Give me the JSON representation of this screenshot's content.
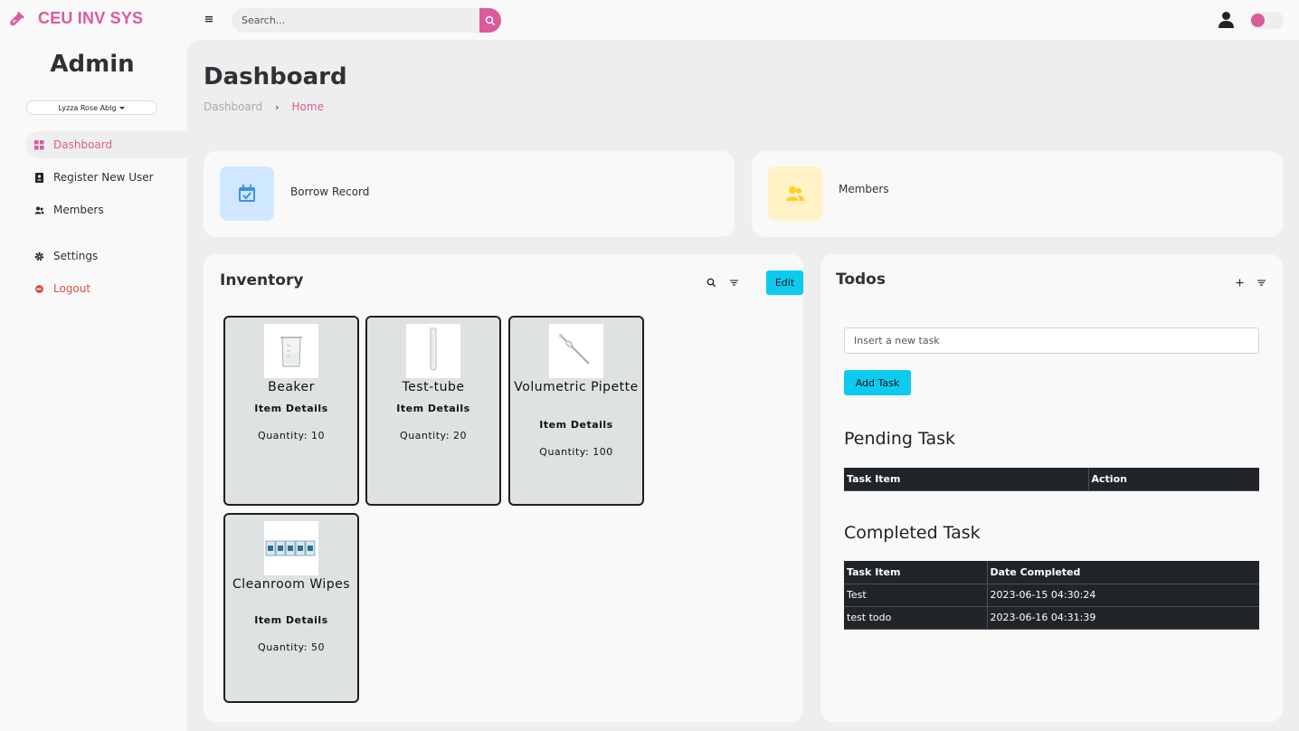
{
  "app": {
    "brand": "CEU INV SYS",
    "brand_color": "#db5a9a",
    "search_placeholder": "Search..."
  },
  "sidebar": {
    "title": "Admin",
    "user_name": "Lyzza Rose Ablg",
    "items": [
      {
        "label": "Dashboard",
        "icon": "grid-icon",
        "active": true
      },
      {
        "label": "Register New User",
        "icon": "id-card-icon"
      },
      {
        "label": "Members",
        "icon": "users-icon"
      },
      {
        "label": "Settings",
        "icon": "gear-icon"
      },
      {
        "label": "Logout",
        "icon": "logout-icon"
      }
    ]
  },
  "page": {
    "title": "Dashboard",
    "breadcrumb": [
      "Dashboard",
      "Home"
    ]
  },
  "stats": [
    {
      "label": "Borrow Record",
      "icon": "calendar-check-icon",
      "icon_bg": "#cfe8ff",
      "icon_color": "#3c91e6"
    },
    {
      "label": "Members",
      "icon": "users-icon",
      "icon_bg": "#fff2c6",
      "icon_color": "#ffce26"
    }
  ],
  "inventory": {
    "title": "Inventory",
    "edit_label": "Edit",
    "details_label": "Item Details",
    "items": [
      {
        "name": "Beaker",
        "quantity": "Quantity: 10",
        "image": "beaker-image"
      },
      {
        "name": "Test-tube",
        "quantity": "Quantity: 20",
        "image": "test-tube-image"
      },
      {
        "name": "Volumetric Pipette",
        "quantity": "Quantity: 100",
        "image": "pipette-image"
      },
      {
        "name": "Cleanroom Wipes",
        "quantity": "Quantity: 50",
        "image": "wipes-image"
      }
    ]
  },
  "todos": {
    "title": "Todos",
    "input_placeholder": "Insert a new task",
    "add_label": "Add Task",
    "pending": {
      "heading": "Pending Task",
      "columns": [
        "Task Item",
        "Action"
      ],
      "rows": []
    },
    "completed": {
      "heading": "Completed Task",
      "columns": [
        "Task Item",
        "Date Completed"
      ],
      "rows": [
        [
          "Test",
          "2023-06-15 04:30:24"
        ],
        [
          "test todo",
          "2023-06-16 04:31:39"
        ]
      ]
    }
  },
  "colors": {
    "accent": "#db5a9a",
    "cyan_button": "#0dcaf0",
    "logout": "#db504a"
  }
}
